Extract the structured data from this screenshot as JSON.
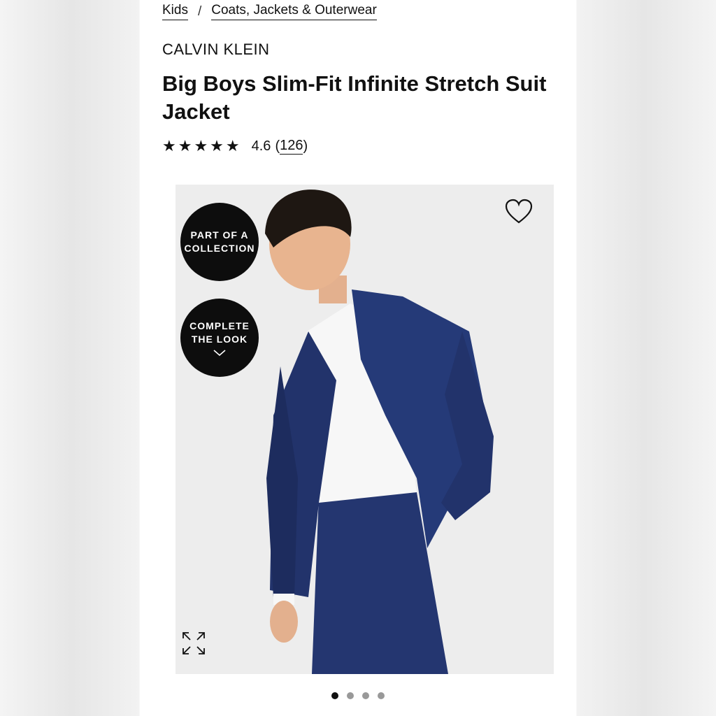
{
  "breadcrumb": {
    "items": [
      "Kids",
      "Coats, Jackets & Outerwear"
    ],
    "separator": "/"
  },
  "product": {
    "brand": "CALVIN KLEIN",
    "title": "Big Boys Slim-Fit Infinite Stretch Suit Jacket",
    "rating": {
      "stars_glyphs": "★★★★★",
      "value": "4.6",
      "count": "126",
      "open_paren": "(",
      "close_paren": ")"
    }
  },
  "gallery": {
    "badges": {
      "collection": {
        "line1": "PART OF A",
        "line2": "COLLECTION"
      },
      "complete": {
        "line1": "COMPLETE",
        "line2": "THE LOOK"
      }
    },
    "icons": [
      "heart-icon",
      "expand-icon",
      "chevron-down-icon"
    ],
    "dot_count": 4,
    "active_dot": 1
  },
  "colors": {
    "suit": "#22336b",
    "badge": "#0d0d0d",
    "photo_bg": "#ededed"
  }
}
